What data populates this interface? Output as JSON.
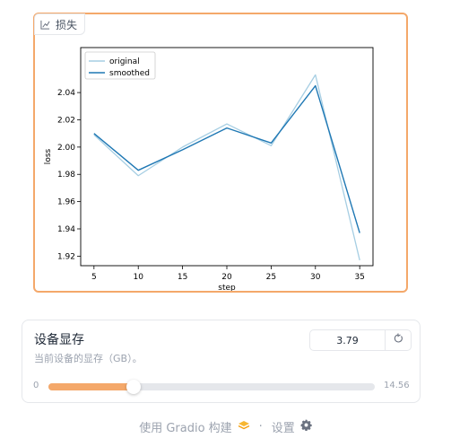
{
  "plot": {
    "label": "损失",
    "label_icon": "chart-icon"
  },
  "chart_data": {
    "type": "line",
    "xlabel": "step",
    "ylabel": "loss",
    "xticks": [
      5,
      10,
      15,
      20,
      25,
      30,
      35
    ],
    "yticks": [
      1.92,
      1.94,
      1.96,
      1.98,
      2.0,
      2.02,
      2.04
    ],
    "ytick_labels": [
      "1.92",
      "1.94",
      "1.96",
      "1.98",
      "2.00",
      "2.02",
      "2.04"
    ],
    "xlim": [
      3.5,
      36.5
    ],
    "ylim": [
      1.913,
      2.073
    ],
    "legend_position": "top-left",
    "series": [
      {
        "name": "original",
        "color": "#a6cee3",
        "x": [
          5,
          10,
          15,
          20,
          25,
          30,
          35
        ],
        "values": [
          2.009,
          1.979,
          2.0,
          2.017,
          2.001,
          2.053,
          1.917
        ]
      },
      {
        "name": "smoothed",
        "color": "#1f78b4",
        "x": [
          5,
          10,
          15,
          20,
          25,
          30,
          35
        ],
        "values": [
          2.01,
          1.983,
          1.998,
          2.014,
          2.003,
          2.045,
          1.937
        ]
      }
    ]
  },
  "slider": {
    "title": "设备显存",
    "info": "当前设备的显存（GB）。",
    "value": "3.79",
    "value_num": 3.79,
    "min": "0",
    "max": "14.56",
    "min_num": 0,
    "max_num": 14.56,
    "reset_icon": "reset-icon",
    "fill_color": "#f4a86a"
  },
  "footer": {
    "built_with": "使用 Gradio 构建",
    "separator": "·",
    "settings": "设置"
  }
}
